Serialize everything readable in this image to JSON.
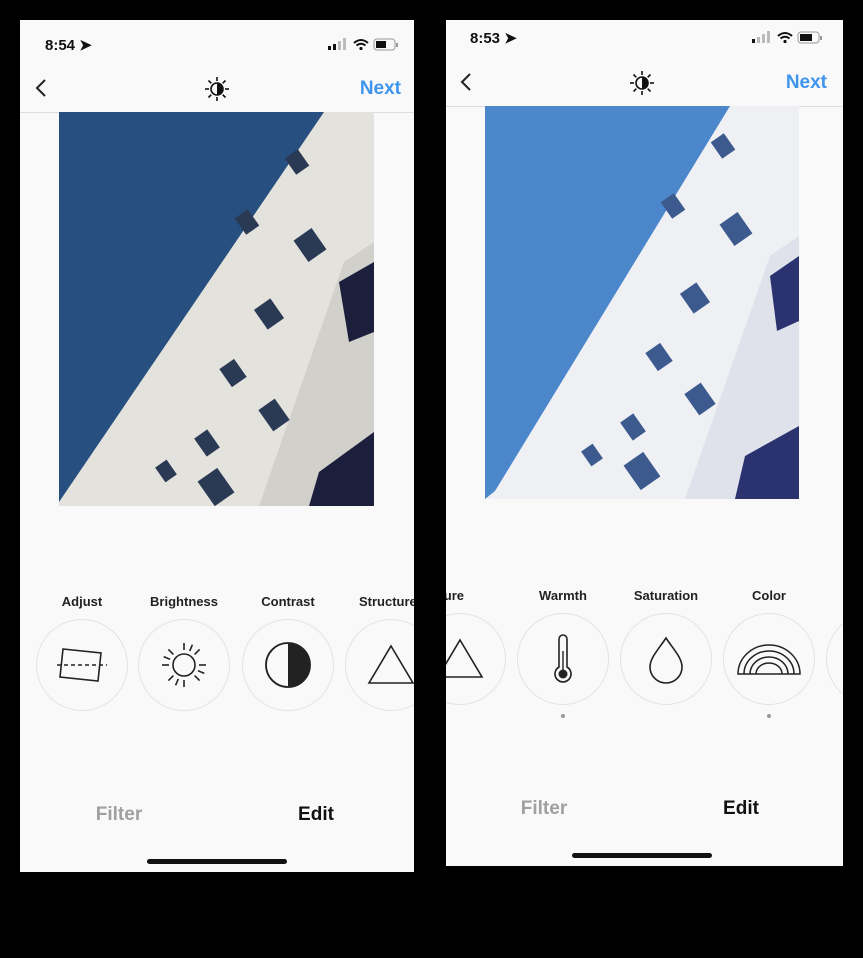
{
  "left": {
    "status": {
      "time": "8:54"
    },
    "nav": {
      "next": "Next",
      "center_icon": "lux-icon"
    },
    "tools": [
      {
        "label": "Adjust",
        "icon": "adjust-icon"
      },
      {
        "label": "Brightness",
        "icon": "sun-icon"
      },
      {
        "label": "Contrast",
        "icon": "contrast-icon"
      },
      {
        "label": "Structure",
        "icon": "triangle-icon"
      }
    ],
    "tabs": {
      "filter": "Filter",
      "edit": "Edit",
      "active": "Edit"
    }
  },
  "right": {
    "status": {
      "time": "8:53"
    },
    "nav": {
      "next": "Next",
      "center_icon": "lux-icon"
    },
    "tools": [
      {
        "label": "Structure",
        "icon": "triangle-icon"
      },
      {
        "label": "Warmth",
        "icon": "thermometer-icon",
        "modified": true
      },
      {
        "label": "Saturation",
        "icon": "drop-icon"
      },
      {
        "label": "Color",
        "icon": "rainbow-icon",
        "modified": true
      }
    ],
    "tabs": {
      "filter": "Filter",
      "edit": "Edit",
      "active": "Edit"
    }
  },
  "colors": {
    "accent": "#3d95ee",
    "sky_left": "#274f7f",
    "sky_right": "#4c87cc"
  }
}
